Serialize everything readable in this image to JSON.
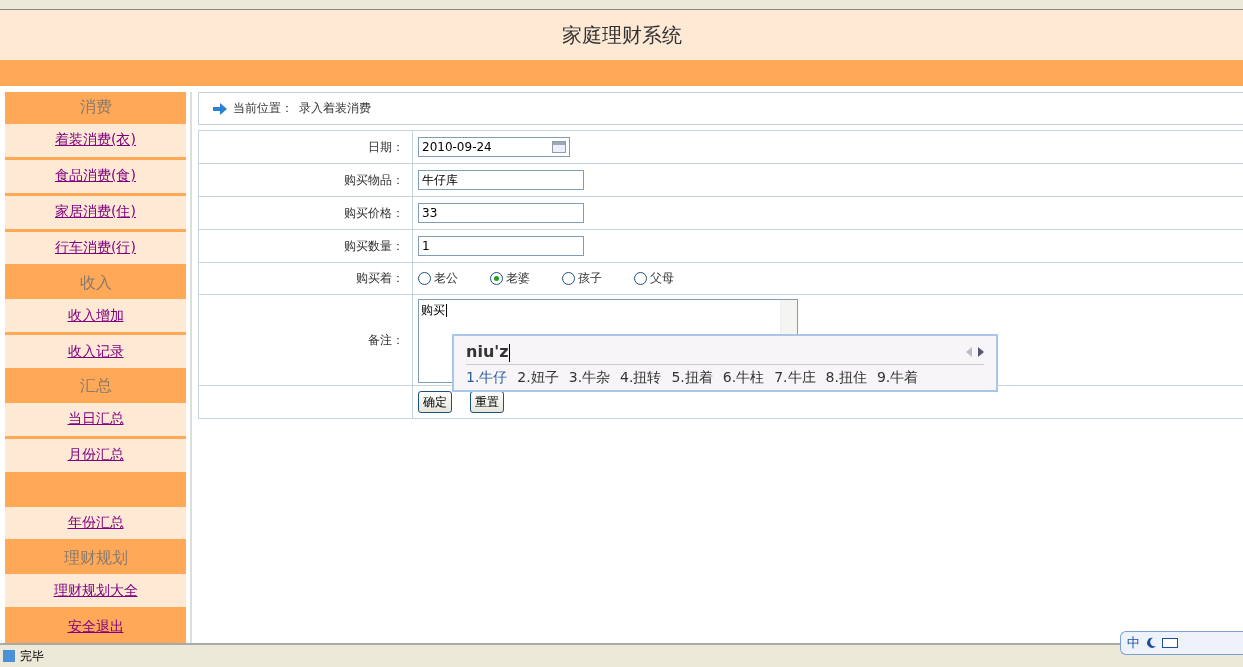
{
  "header": {
    "title": "家庭理财系统"
  },
  "sidebar": [
    {
      "kind": "header",
      "label": "消费"
    },
    {
      "kind": "link",
      "label": "着装消费(衣)"
    },
    {
      "kind": "link",
      "label": "食品消费(食)"
    },
    {
      "kind": "link",
      "label": "家居消费(住)"
    },
    {
      "kind": "link",
      "label": "行车消费(行)"
    },
    {
      "kind": "header",
      "label": "收入"
    },
    {
      "kind": "link",
      "label": "收入增加"
    },
    {
      "kind": "link",
      "label": "收入记录"
    },
    {
      "kind": "header",
      "label": "汇总"
    },
    {
      "kind": "link",
      "label": "当日汇总"
    },
    {
      "kind": "link",
      "label": "月份汇总"
    },
    {
      "kind": "header"
    },
    {
      "kind": "link",
      "label": "年份汇总"
    },
    {
      "kind": "header",
      "label": "理财规划"
    },
    {
      "kind": "link",
      "label": "理财规划大全"
    },
    {
      "kind": "exit",
      "label": "安全退出"
    }
  ],
  "breadcrumb": {
    "label": "当前位置：",
    "value": "录入着装消费"
  },
  "form": {
    "rows": [
      {
        "kind": "date",
        "label": "日期：",
        "value": "2010-09-24"
      },
      {
        "kind": "text",
        "label": "购买物品：",
        "value": "牛仔库"
      },
      {
        "kind": "text",
        "label": "购买价格：",
        "value": "33"
      },
      {
        "kind": "text",
        "label": "购买数量：",
        "value": "1"
      },
      {
        "kind": "radio",
        "label": "购买着：",
        "options": [
          {
            "label": "老公",
            "selected": false
          },
          {
            "label": "老婆",
            "selected": true
          },
          {
            "label": "孩子",
            "selected": false
          },
          {
            "label": "父母",
            "selected": false
          }
        ]
      },
      {
        "kind": "textarea",
        "label": "备注：",
        "value": "购买"
      }
    ],
    "buttons": [
      "确定",
      "重置"
    ]
  },
  "ime": {
    "input": "niu'z",
    "candidates": [
      {
        "label": "1.牛仔",
        "selected": true
      },
      {
        "label": "2.妞子",
        "selected": false
      },
      {
        "label": "3.牛杂",
        "selected": false
      },
      {
        "label": "4.扭转",
        "selected": false
      },
      {
        "label": "5.扭着",
        "selected": false
      },
      {
        "label": "6.牛柱",
        "selected": false
      },
      {
        "label": "7.牛庄",
        "selected": false
      },
      {
        "label": "8.扭住",
        "selected": false
      },
      {
        "label": "9.牛着",
        "selected": false
      }
    ],
    "toolbar_mode": "中"
  },
  "status_bar": {
    "text": "完毕"
  }
}
